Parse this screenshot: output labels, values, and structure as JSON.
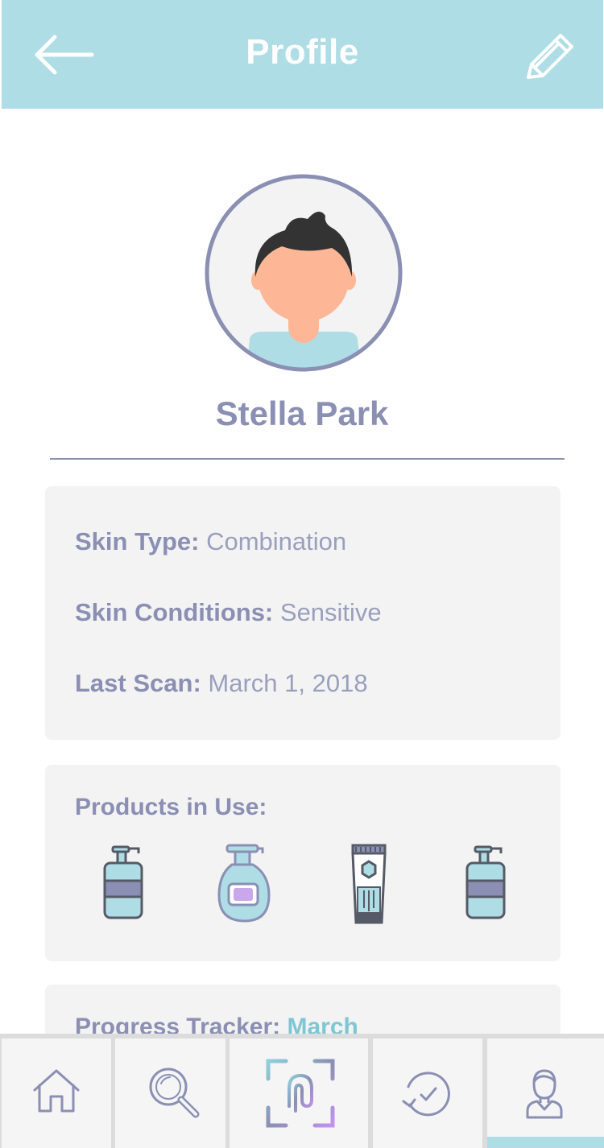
{
  "header": {
    "title": "Profile",
    "back_icon": "arrow-left-icon",
    "edit_icon": "pencil-icon",
    "background": "#aedde6"
  },
  "profile": {
    "name": "Stella Park"
  },
  "details": [
    {
      "label": "Skin Type:",
      "value": "Combination"
    },
    {
      "label": "Skin Conditions:",
      "value": "Sensitive"
    },
    {
      "label": "Last Scan:",
      "value": "March 1, 2018"
    }
  ],
  "products": {
    "title": "Products in Use:",
    "items": [
      {
        "icon": "pump-bottle-icon"
      },
      {
        "icon": "soap-dispenser-icon"
      },
      {
        "icon": "cream-tube-icon"
      },
      {
        "icon": "pump-bottle-icon"
      }
    ]
  },
  "progress": {
    "label": "Progress Tracker:",
    "month": "March"
  },
  "tabbar": {
    "tabs": [
      {
        "name": "home",
        "icon": "home-icon",
        "active": false
      },
      {
        "name": "search",
        "icon": "magnifier-icon",
        "active": false
      },
      {
        "name": "scan",
        "icon": "scan-icon",
        "active": false
      },
      {
        "name": "history",
        "icon": "history-icon",
        "active": false
      },
      {
        "name": "profile",
        "icon": "user-icon",
        "active": true
      }
    ]
  },
  "colors": {
    "accent": "#aedde6",
    "text": "#8a8fb3",
    "highlight": "#7ec7d2",
    "card": "#f3f3f3"
  }
}
